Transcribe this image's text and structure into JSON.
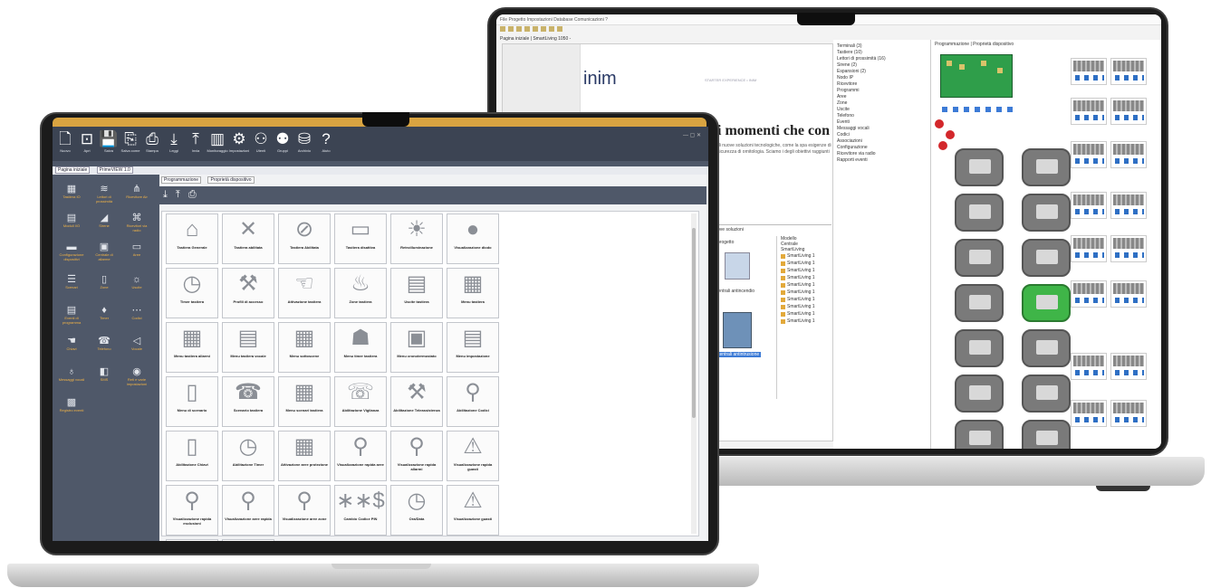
{
  "back_app": {
    "menu": "File  Progetto  Impostazioni  Database  Comunicazioni  ?",
    "tabs": "Progetti recenti | Smartliving 1050",
    "logo": "inim",
    "head_right": "STARTER EXPERIENCE  •  INIM",
    "headline": "i momenti che con",
    "paragraph": "di nuove soluzioni tecnologiche, come la spa esigenze di sicurezza di ornitologia. Sciamo i degli obiettivi raggiunti",
    "lower_header": "ove soluzioni",
    "project_label": "progetto",
    "project_caption": "centrali antincendio",
    "project_selected": "centrali antintrusione",
    "models_header": "Modello",
    "models_sub": "Centrale",
    "models_first": "SmartLiving",
    "models": [
      "SmartLiving 1",
      "SmartLiving 1",
      "SmartLiving 1",
      "SmartLiving 1",
      "SmartLiving 1",
      "SmartLiving 1",
      "SmartLiving 1",
      "SmartLiving 1",
      "SmartLiving 1",
      "SmartLiving 1"
    ],
    "tree": [
      "Terminali (3)",
      "   Tastiere (10)",
      "Lettori di prossimità (16)",
      "   Sirene (2)",
      "Espansioni (2)",
      "Nodo IP",
      "Ricevitore",
      "Programmi",
      "   Aree",
      "   Zone",
      "   Uscite",
      "   Telefono",
      "   Eventi",
      "   Messaggi vocali",
      "   Codici",
      "   Associazioni",
      "Configurazione",
      "Ricevitore via radio",
      "Rapporti eventi"
    ],
    "tree_selected": "Tastiere",
    "right_tabs": "Programmazione | Proprietà dispositivo",
    "window_tabs": "Pagina iniziale | SmartLiving 1050 -"
  },
  "front_app": {
    "toolbar": [
      {
        "icon": "new-file-icon",
        "glyph": "🗋",
        "label": "Nuovo"
      },
      {
        "icon": "open-icon",
        "glyph": "⊡",
        "label": "Apri"
      },
      {
        "icon": "save-icon",
        "glyph": "💾",
        "label": "Salva"
      },
      {
        "icon": "save-as-icon",
        "glyph": "⎘",
        "label": "Salva come"
      },
      {
        "icon": "print-icon",
        "glyph": "⎙",
        "label": "Stampa"
      },
      {
        "icon": "download-icon",
        "glyph": "⤓",
        "label": "Leggi"
      },
      {
        "icon": "upload-icon",
        "glyph": "⤒",
        "label": "Invia"
      },
      {
        "icon": "monitoring-icon",
        "glyph": "▥",
        "label": "Monitoraggio"
      },
      {
        "icon": "settings-icon",
        "glyph": "⚙",
        "label": "Impostazioni"
      },
      {
        "icon": "user-icon",
        "glyph": "⚇",
        "label": "Utenti"
      },
      {
        "icon": "users-icon",
        "glyph": "⚉",
        "label": "Gruppi"
      },
      {
        "icon": "database-icon",
        "glyph": "⛁",
        "label": "Archivio"
      },
      {
        "icon": "help-icon",
        "glyph": "?",
        "label": "Aiuto"
      }
    ],
    "window_controls": "—  ▢  ✕",
    "tabs": [
      "Pagina iniziale",
      "PrimeVIEW 1.0"
    ],
    "sidebar": [
      {
        "icon": "keypad-icon",
        "glyph": "▦",
        "label": "Tastiera IO"
      },
      {
        "icon": "wifi-icon",
        "glyph": "≋",
        "label": "Lettori di prossimità"
      },
      {
        "icon": "antenna-icon",
        "glyph": "⋔",
        "label": "Ricevitore Air"
      },
      {
        "icon": "module-icon",
        "glyph": "▤",
        "label": "Moduli I/O"
      },
      {
        "icon": "signal-icon",
        "glyph": "◢",
        "label": "Sirene"
      },
      {
        "icon": "remote-icon",
        "glyph": "⌘",
        "label": "Ricevitori via radio"
      },
      {
        "icon": "device-icon",
        "glyph": "▬",
        "label": "Configurazione dispositivi"
      },
      {
        "icon": "panel-icon",
        "glyph": "▣",
        "label": "Centrale di allarme"
      },
      {
        "icon": "display-icon",
        "glyph": "▭",
        "label": "Aree"
      },
      {
        "icon": "sliders-icon",
        "glyph": "☰",
        "label": "Scenari"
      },
      {
        "icon": "door-icon",
        "glyph": "▯",
        "label": "Zone"
      },
      {
        "icon": "bulb-icon",
        "glyph": "☼",
        "label": "Uscite"
      },
      {
        "icon": "calendar-icon",
        "glyph": "▤",
        "label": "Eventi di programma"
      },
      {
        "icon": "drop-icon",
        "glyph": "♦",
        "label": "Timer"
      },
      {
        "icon": "dots-icon",
        "glyph": "⋯",
        "label": "Codici"
      },
      {
        "icon": "pointer-icon",
        "glyph": "☚",
        "label": "Chiavi"
      },
      {
        "icon": "phone-icon",
        "glyph": "☎",
        "label": "Telefono"
      },
      {
        "icon": "speaker-icon",
        "glyph": "◁",
        "label": "Vocale"
      },
      {
        "icon": "mic-icon",
        "glyph": "♁",
        "label": "Messaggi vocali"
      },
      {
        "icon": "smartlink-icon",
        "glyph": "◧",
        "label": "SMS"
      },
      {
        "icon": "gauge-icon",
        "glyph": "◉",
        "label": "Reti e varie impostazioni"
      },
      {
        "icon": "grid-icon",
        "glyph": "▩",
        "label": "Registro eventi"
      }
    ],
    "main_tabs": [
      "Programmazione",
      "Proprietà dispositivo"
    ],
    "main_toolbar": "⤓ ⤒ ⎙",
    "tiles": [
      "Tastiera Generale",
      "Tastiera abilitata",
      "Tastiera Abilitata",
      "Tastiera disattiva",
      "Retroilluminazione",
      "Visualizzazione diodo",
      "Timer tastiera",
      "Profili di accesso",
      "Attivazione tastiera",
      "Zone tastiera",
      "Uscite tastiera",
      "Menu tastiera",
      "Menu tastiera allarmi",
      "Menu tastiera vocale",
      "Menu sottoscene",
      "Menu timer tastiera",
      "Menu cronotermostato",
      "Menu impostazione",
      "Menu di scenario",
      "Scenario tastiera",
      "Menu scenari tastiera",
      "Abilitazione Vigilanza",
      "Abilitazione Teleassistenza",
      "Abilitazione Codici",
      "Abilitazione Chiavi",
      "Abilitazione Timer",
      "Attivazione aree protezione",
      "Visualizzazione rapida aree",
      "Visualizzazione rapida allarmi",
      "Visualizzazione rapida guasti",
      "Visualizzazione rapida esclusioni",
      "Visualizzazione aree rapida",
      "Visualizzazione aree zone",
      "Cambio Codice PIN",
      "Ora/Data",
      "Visualizzazione guasti"
    ],
    "tile_glyphs": [
      "⌂",
      "✕",
      "⊘",
      "▭",
      "☀",
      "●",
      "◷",
      "⚒",
      "☜",
      "♨",
      "▤",
      "▦",
      "▦",
      "▤",
      "▦",
      "☗",
      "▣",
      "▤",
      "▯",
      "☎",
      "▦",
      "☏",
      "⚒",
      "⚲",
      "▯",
      "◷",
      "▦",
      "⚲",
      "⚲",
      "⚠",
      "⚲",
      "⚲",
      "⚲",
      "∗∗$",
      "◷",
      "⚠"
    ]
  }
}
